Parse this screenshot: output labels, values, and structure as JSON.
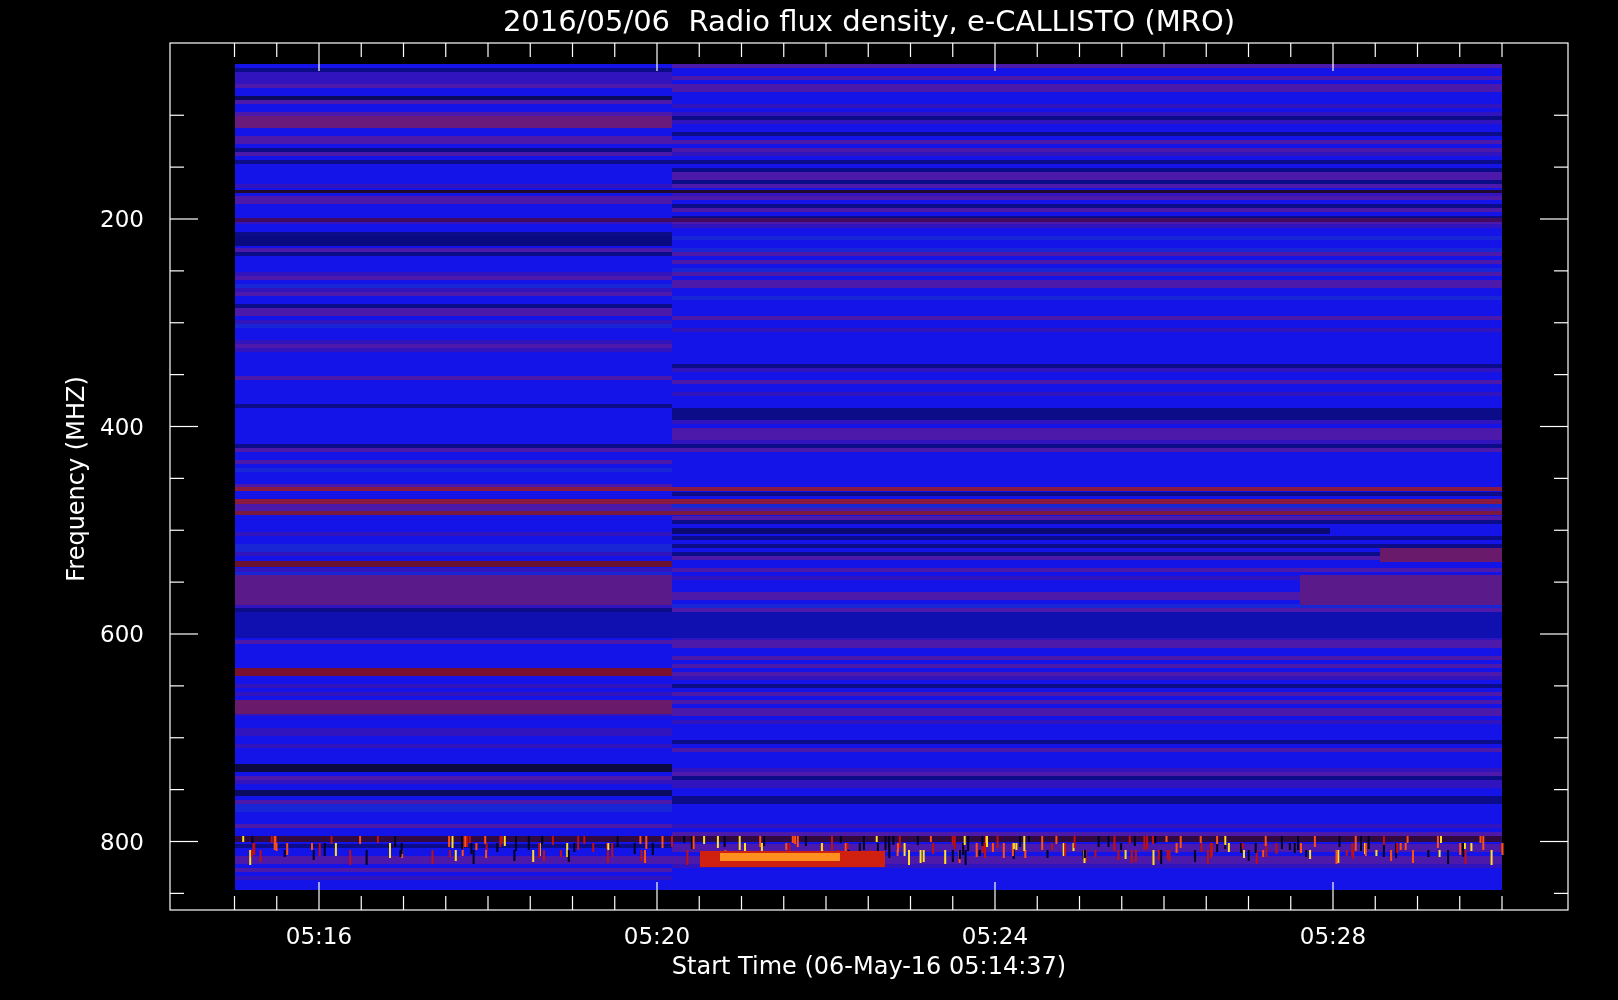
{
  "title": "2016/05/06  Radio flux density, e-CALLISTO (MRO)",
  "spectrogram": {
    "xlabel": "Start Time (06-May-16 05:14:37)",
    "ylabel": "Frequency (MHZ)",
    "xticks": [
      "05:16",
      "05:20",
      "05:24",
      "05:28"
    ],
    "yticks": [
      "200",
      "400",
      "600",
      "800"
    ]
  }
}
